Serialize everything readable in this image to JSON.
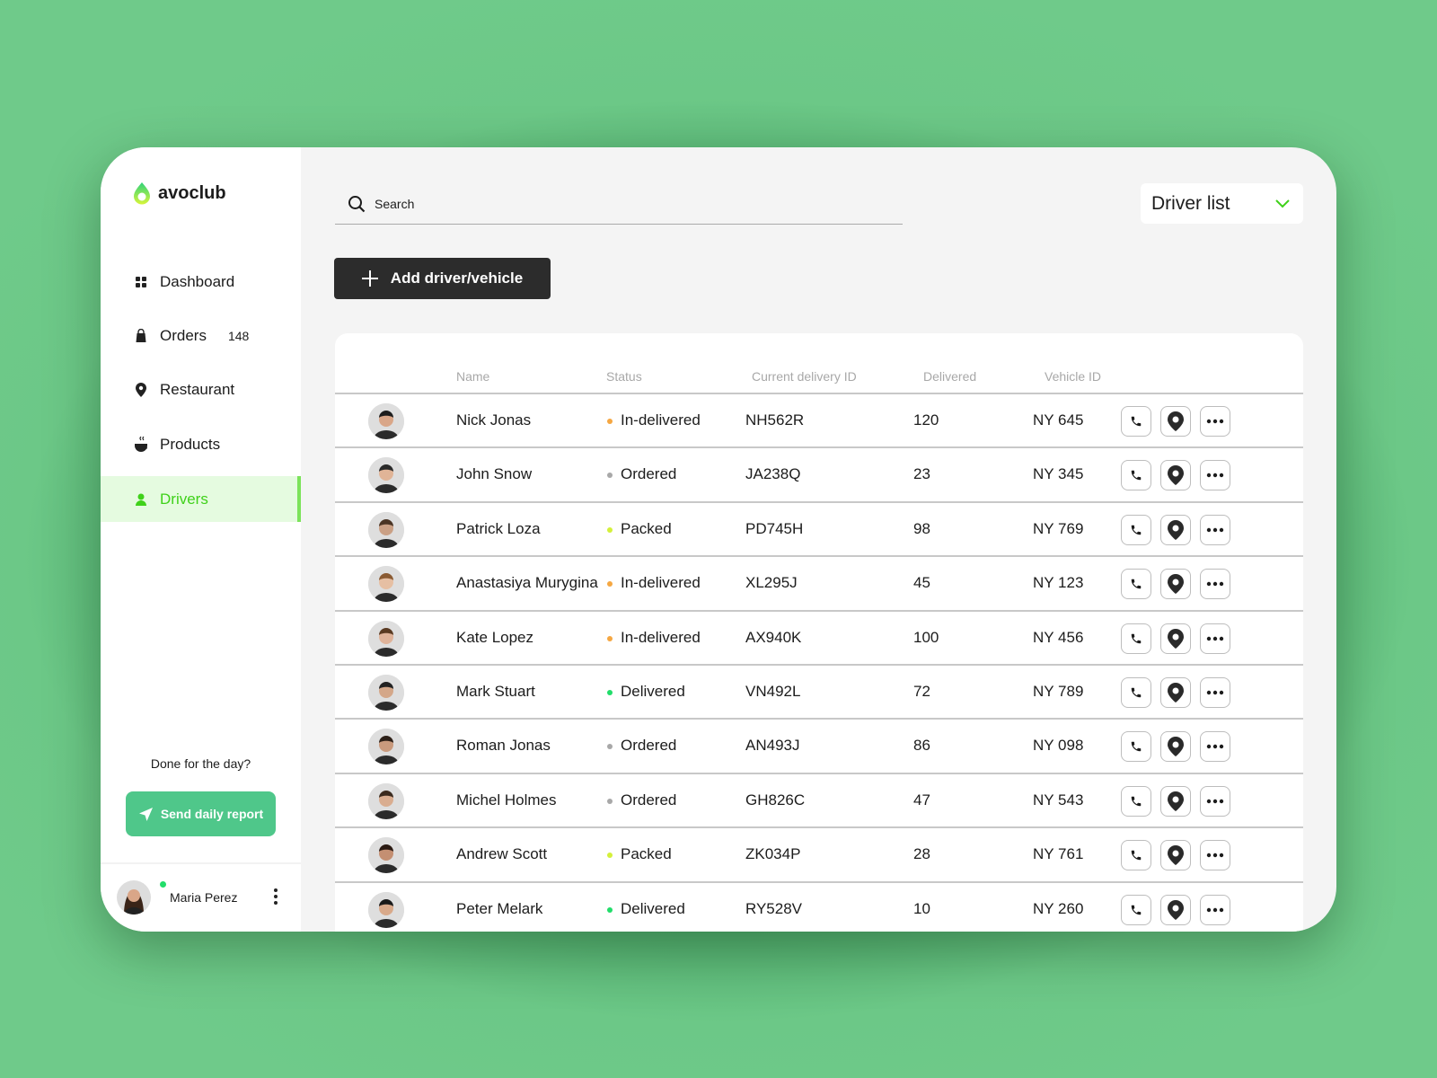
{
  "brand": {
    "name": "avoclub",
    "accent": "#3fd11a",
    "button_green": "#4fc78a"
  },
  "sidebar": {
    "items": [
      {
        "label": "Dashboard",
        "icon": "grid-icon"
      },
      {
        "label": "Orders",
        "icon": "bag-icon",
        "badge": "148"
      },
      {
        "label": "Restaurant",
        "icon": "pin-icon"
      },
      {
        "label": "Products",
        "icon": "coffee-icon"
      },
      {
        "label": "Drivers",
        "icon": "person-icon",
        "active": true
      }
    ],
    "prompt": "Done for the day?",
    "send_label": "Send daily report",
    "user": {
      "name": "Maria Perez",
      "online": true
    }
  },
  "search": {
    "placeholder": "Search"
  },
  "view_select": {
    "value": "Driver list"
  },
  "add_label": "Add driver/vehicle",
  "table": {
    "columns": [
      "Name",
      "Status",
      "Current delivery ID",
      "Delivered",
      "Vehicle ID"
    ],
    "status_colors": {
      "In-delivered": "#f5a742",
      "Ordered": "#a8a8a8",
      "Packed": "#d4f03a",
      "Delivered": "#22dd6a"
    },
    "rows": [
      {
        "name": "Nick Jonas",
        "status": "In-delivered",
        "delivery": "NH562R",
        "delivered": "120",
        "vehicle": "NY 645"
      },
      {
        "name": "John Snow",
        "status": "Ordered",
        "delivery": "JA238Q",
        "delivered": "23",
        "vehicle": "NY 345"
      },
      {
        "name": "Patrick Loza",
        "status": "Packed",
        "delivery": "PD745H",
        "delivered": "98",
        "vehicle": "NY 769"
      },
      {
        "name": "Anastasiya Murygina",
        "status": "In-delivered",
        "delivery": "XL295J",
        "delivered": "45",
        "vehicle": "NY 123"
      },
      {
        "name": "Kate Lopez",
        "status": "In-delivered",
        "delivery": "AX940K",
        "delivered": "100",
        "vehicle": "NY 456"
      },
      {
        "name": "Mark Stuart",
        "status": "Delivered",
        "delivery": "VN492L",
        "delivered": "72",
        "vehicle": "NY 789"
      },
      {
        "name": "Roman Jonas",
        "status": "Ordered",
        "delivery": "AN493J",
        "delivered": "86",
        "vehicle": "NY 098"
      },
      {
        "name": "Michel Holmes",
        "status": "Ordered",
        "delivery": "GH826C",
        "delivered": "47",
        "vehicle": "NY 543"
      },
      {
        "name": "Andrew Scott",
        "status": "Packed",
        "delivery": "ZK034P",
        "delivered": "28",
        "vehicle": "NY 761"
      },
      {
        "name": "Peter Melark",
        "status": "Delivered",
        "delivery": "RY528V",
        "delivered": "10",
        "vehicle": "NY 260"
      }
    ]
  }
}
